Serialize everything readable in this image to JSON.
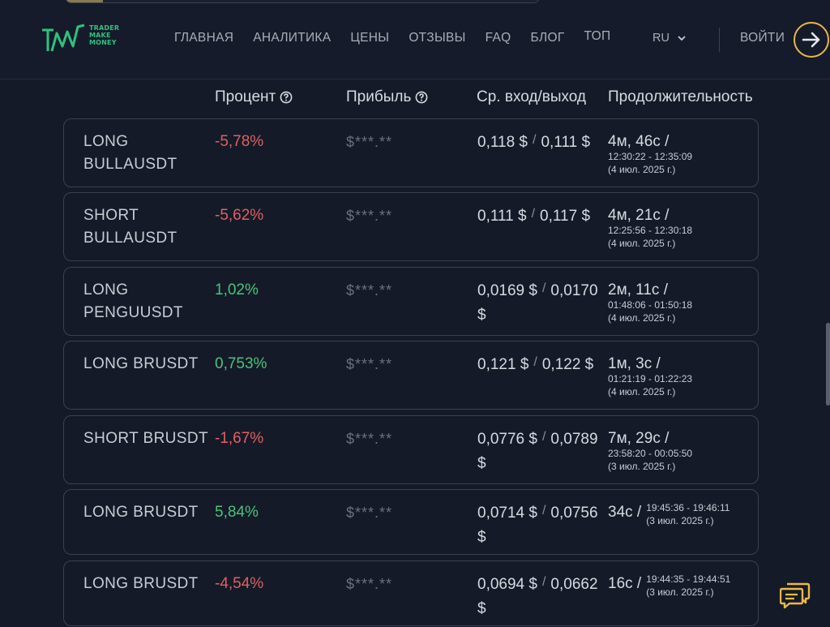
{
  "header": {
    "logo_lines": [
      "TRADER",
      "MAKE",
      "MONEY"
    ],
    "nav": [
      "ГЛАВНАЯ",
      "АНАЛИТИКА",
      "ЦЕНЫ",
      "ОТЗЫВЫ",
      "FAQ",
      "БЛОГ",
      "ТОП"
    ],
    "lang": "RU",
    "login": "ВОЙТИ"
  },
  "columns": {
    "percent": "Процент",
    "profit": "Прибыль",
    "entry_exit": "Ср. вход/выход",
    "duration": "Продолжительность"
  },
  "trades": [
    {
      "name": "LONG BULLAUSDT",
      "percent": "-5,78%",
      "sign": "neg",
      "profit": "$***.**",
      "entry": "0,118 $",
      "exit": "0,111 $",
      "duration": "4м, 46с /",
      "time": "12:30:22 - 12:35:09",
      "date": "(4 июл. 2025 г.)"
    },
    {
      "name": "SHORT BULLAUSDT",
      "percent": "-5,62%",
      "sign": "neg",
      "profit": "$***.**",
      "entry": "0,111 $",
      "exit": "0,117 $",
      "duration": "4м, 21с /",
      "time": "12:25:56 - 12:30:18",
      "date": "(4 июл. 2025 г.)"
    },
    {
      "name": "LONG PENGUUSDT",
      "percent": "1,02%",
      "sign": "pos",
      "profit": "$***.**",
      "entry": "0,0169 $",
      "exit": "0,0170 $",
      "duration": "2м, 11с /",
      "time": "01:48:06 - 01:50:18",
      "date": "(4 июл. 2025 г.)"
    },
    {
      "name": "LONG BRUSDT",
      "percent": "0,753%",
      "sign": "pos",
      "profit": "$***.**",
      "entry": "0,121 $",
      "exit": "0,122 $",
      "duration": "1м, 3с /",
      "time": "01:21:19 - 01:22:23",
      "date": "(4 июл. 2025 г.)"
    },
    {
      "name": "SHORT BRUSDT",
      "percent": "-1,67%",
      "sign": "neg",
      "profit": "$***.**",
      "entry": "0,0776 $",
      "exit": "0,0789 $",
      "duration": "7м, 29с /",
      "time": "23:58:20 - 00:05:50",
      "date": "(3 июл. 2025 г.)"
    },
    {
      "name": "LONG BRUSDT",
      "percent": "5,84%",
      "sign": "pos",
      "profit": "$***.**",
      "entry": "0,0714 $",
      "exit": "0,0756 $",
      "duration": "34с /",
      "time": "19:45:36 - 19:46:11",
      "date": "(3 июл. 2025 г.)"
    },
    {
      "name": "LONG BRUSDT",
      "percent": "-4,54%",
      "sign": "neg",
      "profit": "$***.**",
      "entry": "0,0694 $",
      "exit": "0,0662 $",
      "duration": "16с /",
      "time": "19:44:35 - 19:44:51",
      "date": "(3 июл. 2025 г.)"
    }
  ],
  "colors": {
    "negative": "#e06060",
    "positive": "#4cc27a",
    "accent": "#e9b84a",
    "brand": "#2ec27e"
  },
  "icons": {
    "help": "help-circle-icon",
    "login": "arrow-right-icon",
    "chat": "chat-bubbles-icon",
    "lang": "chevron-down-icon"
  }
}
